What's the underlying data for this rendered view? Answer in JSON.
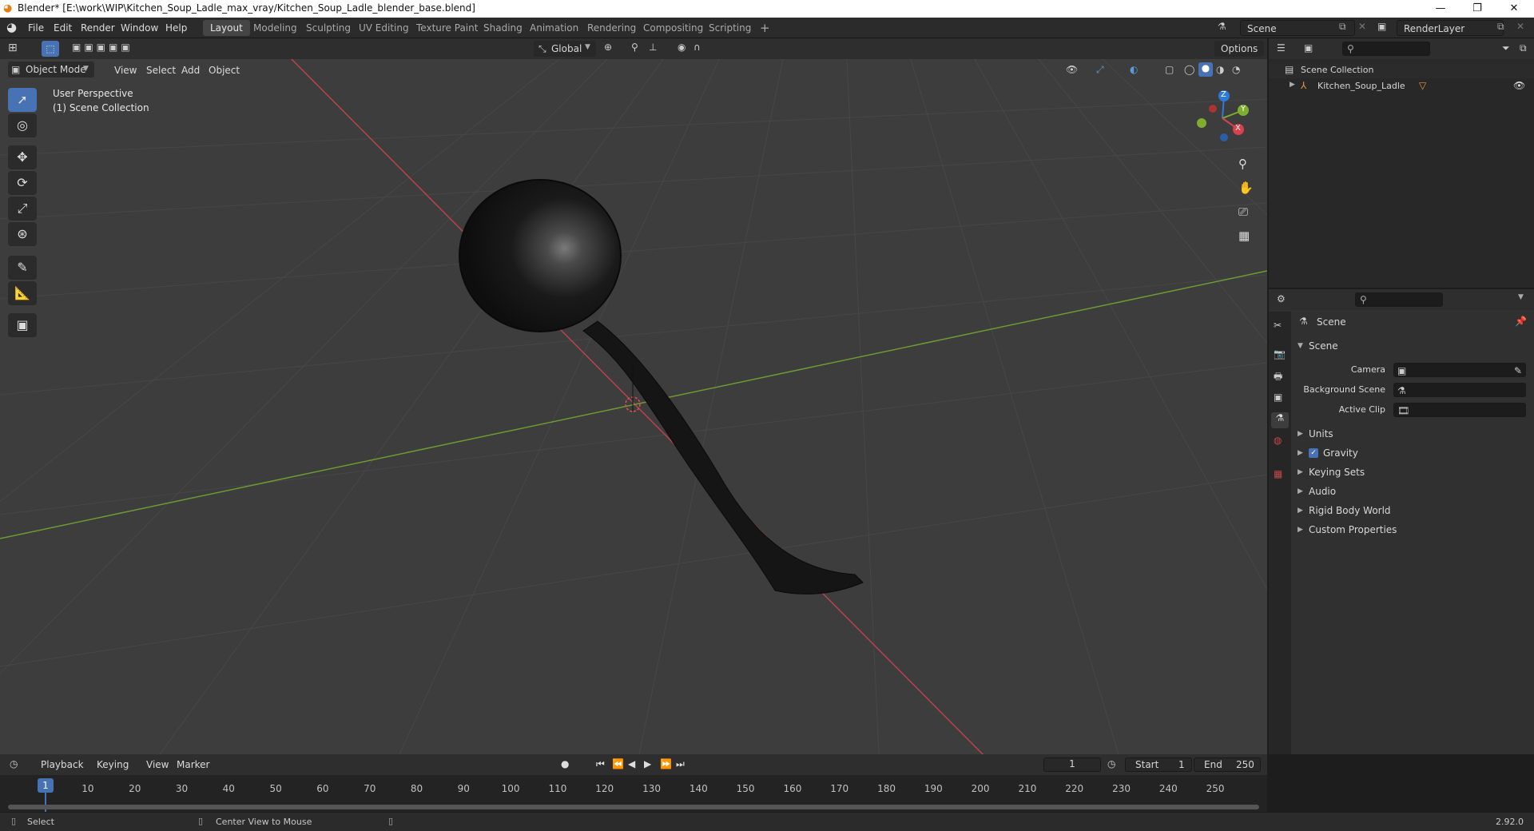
{
  "window": {
    "title": "Blender* [E:\\work\\WIP\\Kitchen_Soup_Ladle_max_vray/Kitchen_Soup_Ladle_blender_base.blend]",
    "minimize": "—",
    "maximize": "❐",
    "close": "✕"
  },
  "menu": [
    "File",
    "Edit",
    "Render",
    "Window",
    "Help"
  ],
  "workspaces": [
    "Layout",
    "Modeling",
    "Sculpting",
    "UV Editing",
    "Texture Paint",
    "Shading",
    "Animation",
    "Rendering",
    "Compositing",
    "Scripting"
  ],
  "add_workspace": "+",
  "scene": {
    "name": "Scene",
    "view_layer": "RenderLayer"
  },
  "viewport": {
    "mode": "Object Mode",
    "menus": [
      "View",
      "Select",
      "Add",
      "Object"
    ],
    "transform_orientation": "Global",
    "options": "Options",
    "overlay_line1": "User Perspective",
    "overlay_line2": "(1) Scene Collection",
    "gizmo": {
      "z": "Z",
      "y": "Y",
      "x": "X"
    }
  },
  "outliner": {
    "collection": "Scene Collection",
    "object": "Kitchen_Soup_Ladle"
  },
  "properties": {
    "context": "Scene",
    "panel": "Scene",
    "fields": [
      {
        "label": "Camera",
        "value": ""
      },
      {
        "label": "Background Scene",
        "value": ""
      },
      {
        "label": "Active Clip",
        "value": ""
      }
    ],
    "sections": [
      "Units",
      "Gravity",
      "Keying Sets",
      "Audio",
      "Rigid Body World",
      "Custom Properties"
    ],
    "gravity_checked": true
  },
  "timeline": {
    "menus": [
      "Playback",
      "Keying",
      "View",
      "Marker"
    ],
    "current_frame": "1",
    "start_label": "Start",
    "start": "1",
    "end_label": "End",
    "end": "250",
    "ticks": [
      "1",
      "10",
      "20",
      "30",
      "40",
      "50",
      "60",
      "70",
      "80",
      "90",
      "100",
      "110",
      "120",
      "130",
      "140",
      "150",
      "160",
      "170",
      "180",
      "190",
      "200",
      "210",
      "220",
      "230",
      "240",
      "250"
    ]
  },
  "status": {
    "left": "Select",
    "middle": "Center View to Mouse",
    "version": "2.92.0"
  },
  "colors": {
    "accent": "#4772b3",
    "viewport_bg": "#3d3d3d",
    "x_axis": "#d9414f",
    "y_axis": "#7fae2e",
    "z_axis": "#2f7ad9"
  }
}
